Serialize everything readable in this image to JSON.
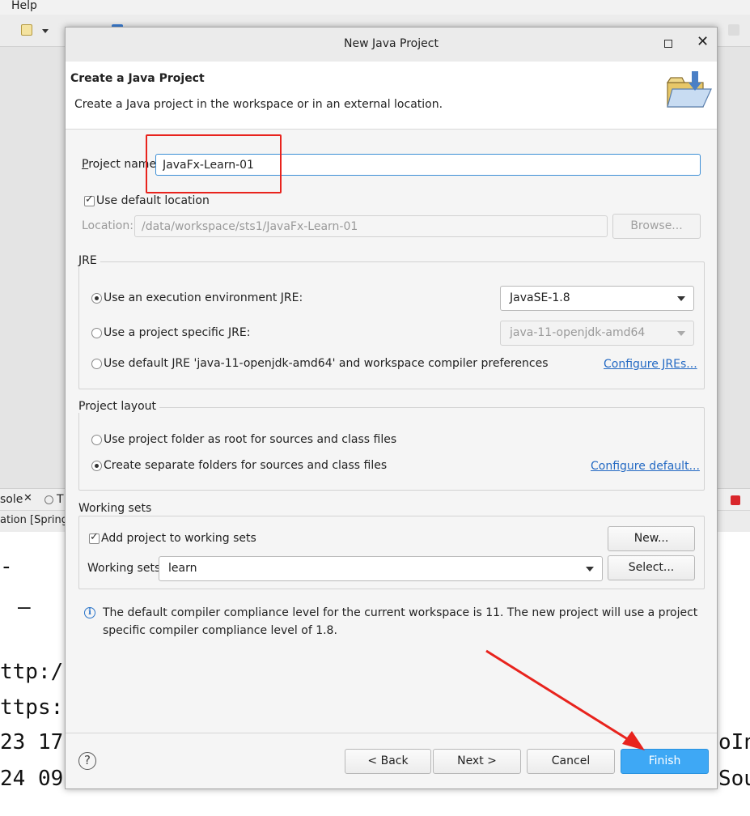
{
  "ide": {
    "menu_help": "Help",
    "console_tab_label": "sole",
    "console_tab2_label": "T",
    "console_subtitle": "ation [Spring",
    "console_lines": [
      "ttp:/",
      "ttps:",
      "23 17",
      "24 09"
    ],
    "console_right_lines": [
      "oInt",
      "Sou"
    ]
  },
  "dialog": {
    "title": "New Java Project",
    "header": {
      "title": "Create a Java Project",
      "description": "Create a Java project in the workspace or in an external location."
    },
    "project_name": {
      "label": "Project name:",
      "value": "JavaFx-Learn-01"
    },
    "use_default_location": {
      "label": "Use default location",
      "checked": true
    },
    "location": {
      "label": "Location:",
      "value": "/data/workspace/sts1/JavaFx-Learn-01",
      "browse_label": "Browse..."
    },
    "jre": {
      "group_title": "JRE",
      "option_execution_env": "Use an execution environment JRE:",
      "execution_env_value": "JavaSE-1.8",
      "option_project_specific": "Use a project specific JRE:",
      "project_specific_value": "java-11-openjdk-amd64",
      "option_default": "Use default JRE 'java-11-openjdk-amd64' and workspace compiler preferences",
      "configure_link": "Configure JREs..."
    },
    "layout": {
      "group_title": "Project layout",
      "option_root": "Use project folder as root for sources and class files",
      "option_separate": "Create separate folders for sources and class files",
      "configure_link": "Configure default..."
    },
    "working_sets": {
      "group_title": "Working sets",
      "add_label": "Add project to working sets",
      "checked": true,
      "new_button": "New...",
      "sets_label": "Working sets:",
      "sets_value": "learn",
      "select_button": "Select..."
    },
    "info_message": "The default compiler compliance level for the current workspace is 11. The new project will use a project specific compiler compliance level of 1.8.",
    "footer": {
      "back": "< Back",
      "next": "Next >",
      "cancel": "Cancel",
      "finish": "Finish"
    }
  },
  "colors": {
    "finish_button": "#3ea8f5",
    "annotation": "#e8231d",
    "link": "#2369c3",
    "focus_border": "#3d8fd6"
  }
}
